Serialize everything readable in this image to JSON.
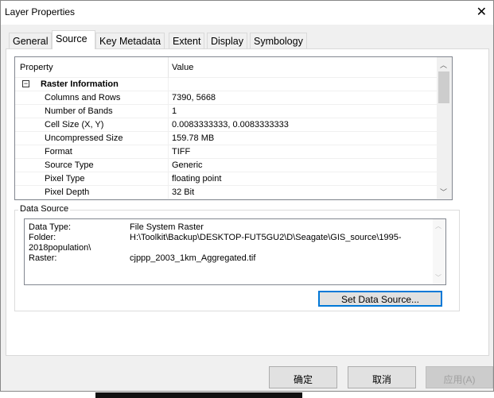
{
  "title": "Layer Properties",
  "tabs": [
    "General",
    "Source",
    "Key Metadata",
    "Extent",
    "Display",
    "Symbology"
  ],
  "grid": {
    "headers": [
      "Property",
      "Value"
    ],
    "section": "Raster Information",
    "rows": [
      {
        "p": "Columns and Rows",
        "v": "7390, 5668"
      },
      {
        "p": "Number of Bands",
        "v": "1"
      },
      {
        "p": "Cell Size (X, Y)",
        "v": "0.0083333333, 0.0083333333"
      },
      {
        "p": "Uncompressed Size",
        "v": "159.78 MB"
      },
      {
        "p": "Format",
        "v": "TIFF"
      },
      {
        "p": "Source Type",
        "v": "Generic"
      },
      {
        "p": "Pixel Type",
        "v": "floating point"
      },
      {
        "p": "Pixel Depth",
        "v": "32 Bit"
      }
    ]
  },
  "data_source": {
    "label": "Data Source",
    "data_type_label": "Data Type:",
    "data_type": "File System Raster",
    "folder_label": "Folder:",
    "folder": "H:\\Toolkit\\Backup\\DESKTOP-FUT5GU2\\D\\Seagate\\GIS_source\\1995-",
    "folder_cont": "2018population\\",
    "raster_label": "Raster:",
    "raster": "cjppp_2003_1km_Aggregated.tif",
    "set_button": "Set Data Source..."
  },
  "buttons": {
    "ok": "确定",
    "cancel": "取消",
    "apply": "应用(A)"
  }
}
